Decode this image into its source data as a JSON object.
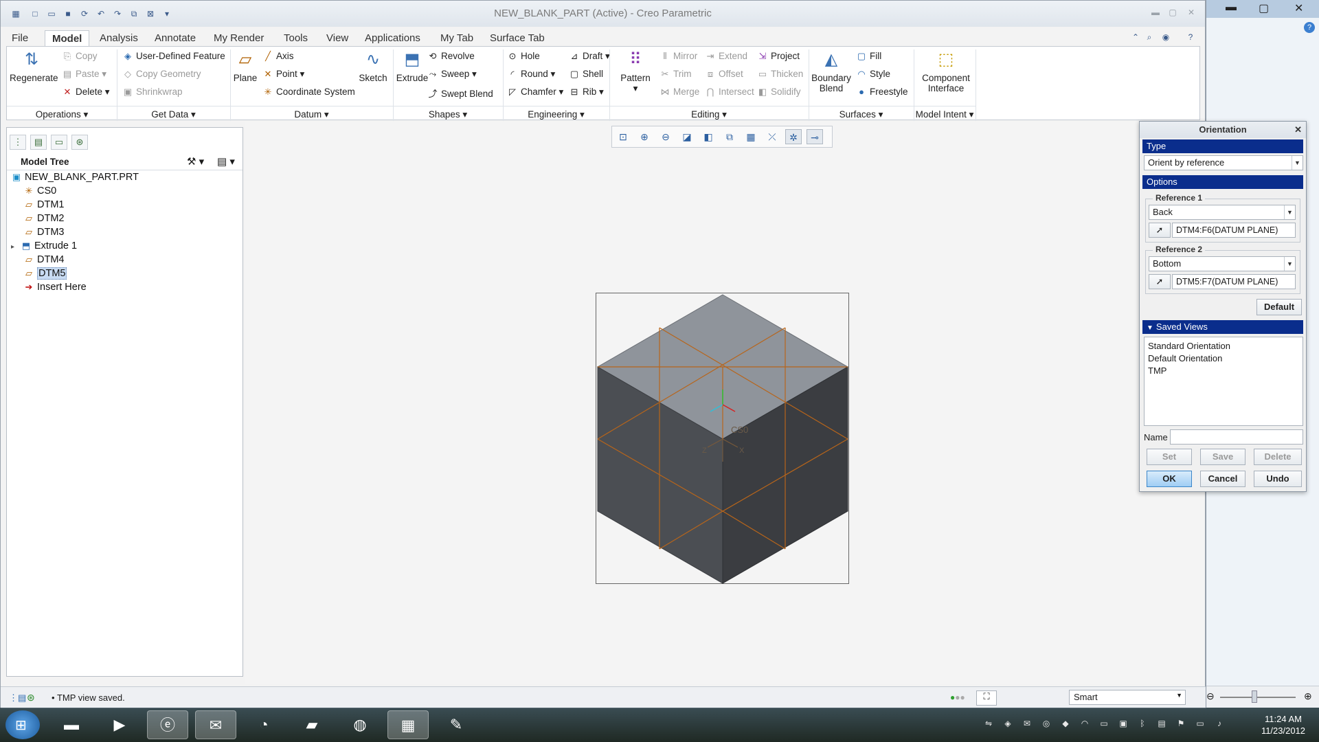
{
  "window": {
    "title": "NEW_BLANK_PART (Active) - Creo Parametric"
  },
  "tabs": [
    "File",
    "Model",
    "Analysis",
    "Annotate",
    "My Render",
    "Tools",
    "View",
    "Applications",
    "My Tab",
    "Surface Tab"
  ],
  "ribbon": {
    "operations": {
      "regenerate": "Regenerate",
      "copy": "Copy",
      "paste": "Paste",
      "delete": "Delete",
      "group": "Operations"
    },
    "get_data": {
      "user_defined_feature": "User-Defined Feature",
      "copy_geometry": "Copy Geometry",
      "shrinkwrap": "Shrinkwrap",
      "group": "Get Data"
    },
    "datum": {
      "plane": "Plane",
      "axis": "Axis",
      "point": "Point",
      "coordinate_system": "Coordinate System",
      "sketch": "Sketch",
      "group": "Datum"
    },
    "shapes": {
      "extrude": "Extrude",
      "revolve": "Revolve",
      "sweep": "Sweep",
      "swept_blend": "Swept Blend",
      "group": "Shapes"
    },
    "engineering": {
      "hole": "Hole",
      "round": "Round",
      "chamfer": "Chamfer",
      "draft": "Draft",
      "shell": "Shell",
      "rib": "Rib",
      "group": "Engineering"
    },
    "editing": {
      "pattern": "Pattern",
      "mirror": "Mirror",
      "trim": "Trim",
      "merge": "Merge",
      "extend": "Extend",
      "offset": "Offset",
      "intersect": "Intersect",
      "project": "Project",
      "thicken": "Thicken",
      "solidify": "Solidify",
      "group": "Editing"
    },
    "surfaces": {
      "boundary_blend_1": "Boundary",
      "boundary_blend_2": "Blend",
      "fill": "Fill",
      "style": "Style",
      "freestyle": "Freestyle",
      "group": "Surfaces"
    },
    "model_intent": {
      "component_interface_1": "Component",
      "component_interface_2": "Interface",
      "group": "Model Intent"
    }
  },
  "model_tree": {
    "header": "Model Tree",
    "items": [
      {
        "label": "NEW_BLANK_PART.PRT",
        "icon": "part-icon"
      },
      {
        "label": "CS0",
        "icon": "csys-icon"
      },
      {
        "label": "DTM1",
        "icon": "datum-plane-icon"
      },
      {
        "label": "DTM2",
        "icon": "datum-plane-icon"
      },
      {
        "label": "DTM3",
        "icon": "datum-plane-icon"
      },
      {
        "label": "Extrude 1",
        "icon": "extrude-icon"
      },
      {
        "label": "DTM4",
        "icon": "datum-plane-icon"
      },
      {
        "label": "DTM5",
        "icon": "datum-plane-icon",
        "selected": true
      },
      {
        "label": "Insert Here",
        "icon": "insert-arrow-icon"
      }
    ]
  },
  "graphics": {
    "csys_label": "CS0",
    "axis_z": "Z",
    "axis_x": "X"
  },
  "status": {
    "message": "TMP view saved.",
    "selection_filter": "Smart"
  },
  "orientation_dialog": {
    "title": "Orientation",
    "type_header": "Type",
    "type_value": "Orient by reference",
    "options_header": "Options",
    "ref1_label": "Reference 1",
    "ref1_direction": "Back",
    "ref1_value": "DTM4:F6(DATUM PLANE)",
    "ref2_label": "Reference 2",
    "ref2_direction": "Bottom",
    "ref2_value": "DTM5:F7(DATUM PLANE)",
    "default_button": "Default",
    "saved_views_header": "Saved Views",
    "saved_views": [
      "Standard Orientation",
      "Default Orientation",
      "TMP"
    ],
    "name_label": "Name",
    "name_value": "",
    "set_button": "Set",
    "save_button": "Save",
    "delete_button": "Delete",
    "ok_button": "OK",
    "cancel_button": "Cancel",
    "undo_button": "Undo"
  },
  "taskbar": {
    "time": "11:24 AM",
    "date": "11/23/2012"
  },
  "colors": {
    "dialog_header_blue": "#0a2d8c",
    "cube_top": "#8e939a",
    "cube_left": "#4a4d52",
    "cube_right": "#3a3c40",
    "datum_lines": "#b8651a"
  }
}
